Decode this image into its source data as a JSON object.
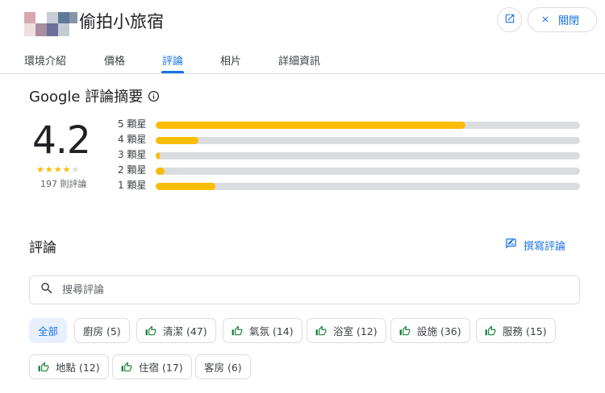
{
  "header": {
    "title": "偷拍小旅宿",
    "open_icon": "open-in-new-icon",
    "close_label": "關閉",
    "close_icon": "close-icon"
  },
  "tabs": [
    {
      "label": "環境介紹",
      "active": false
    },
    {
      "label": "價格",
      "active": false
    },
    {
      "label": "評論",
      "active": true
    },
    {
      "label": "相片",
      "active": false
    },
    {
      "label": "詳細資訊",
      "active": false
    }
  ],
  "summary": {
    "title": "Google 評論摘要",
    "info_icon": "info-icon",
    "rating": "4.2",
    "stars_filled": 4,
    "stars_total": 5,
    "review_count": "197 則評論",
    "bars": [
      {
        "label": "5 顆星",
        "fraction": 0.73
      },
      {
        "label": "4 顆星",
        "fraction": 0.1
      },
      {
        "label": "3 顆星",
        "fraction": 0.01
      },
      {
        "label": "2 顆星",
        "fraction": 0.02
      },
      {
        "label": "1 顆星",
        "fraction": 0.14
      }
    ]
  },
  "reviews": {
    "heading": "評論",
    "write_label": "撰寫評論",
    "write_icon": "rate-review-icon",
    "search_placeholder": "搜尋評論",
    "search_icon": "search-icon",
    "chips": [
      {
        "label": "全部",
        "selected": true,
        "thumb": false
      },
      {
        "label": "廚房 (5)",
        "selected": false,
        "thumb": false
      },
      {
        "label": "清潔 (47)",
        "selected": false,
        "thumb": true
      },
      {
        "label": "氣氛 (14)",
        "selected": false,
        "thumb": true
      },
      {
        "label": "浴室 (12)",
        "selected": false,
        "thumb": true
      },
      {
        "label": "設施 (36)",
        "selected": false,
        "thumb": true
      },
      {
        "label": "服務 (15)",
        "selected": false,
        "thumb": true
      },
      {
        "label": "地點 (12)",
        "selected": false,
        "thumb": true
      },
      {
        "label": "住宿 (17)",
        "selected": false,
        "thumb": true
      },
      {
        "label": "客房 (6)",
        "selected": false,
        "thumb": false
      }
    ]
  },
  "colors": {
    "accent": "#1a73e8",
    "star": "#fbbc04",
    "thumb": "#188038",
    "track": "#dadce0"
  }
}
